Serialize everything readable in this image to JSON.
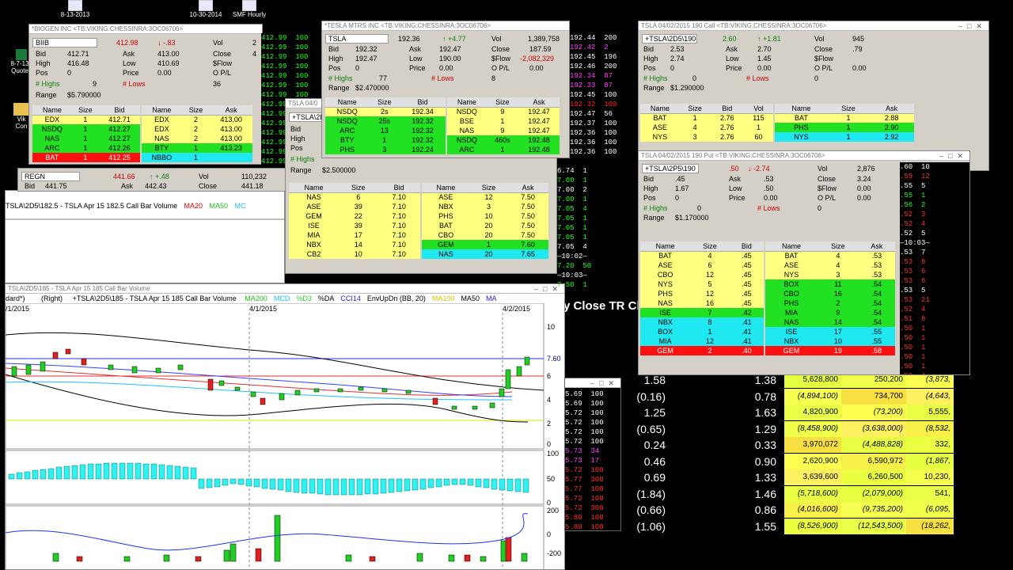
{
  "desktop": {
    "icons": [
      {
        "label": "8-13-2013"
      },
      {
        "label": "10-30-2014"
      },
      {
        "label": "SMF Hourly"
      },
      {
        "label": "8-7-13 Quote"
      },
      {
        "label": "Vik Con"
      }
    ]
  },
  "biib": {
    "title": "*BIOGEN INC <TB:VIKING:CHESSINRA:3OC06706>",
    "symbol": "BIIB",
    "last": "412.98",
    "change": "↓ -.83",
    "vol_label": "Vol",
    "vol": "2",
    "bid_label": "Bid",
    "bid": "412.71",
    "ask_label": "Ask",
    "ask": "413.00",
    "close_label": "Close",
    "close": "4",
    "high_label": "High",
    "high": "416.48",
    "low_label": "Low",
    "low": "410.69",
    "sflow_label": "$Flow",
    "sflow": "",
    "pos_label": "Pos",
    "pos": "0",
    "price_label": "Price",
    "price": "0.00",
    "opl_label": "O P/L",
    "opl": "",
    "highs_label": "# Highs",
    "highs": "9",
    "lows_label": "# Lows",
    "lows": "36",
    "range_label": "Range",
    "range": "$5.790000",
    "headers": [
      "Name",
      "Size",
      "Bid",
      "Name",
      "Size",
      "Ask"
    ],
    "bids": [
      {
        "n": "EDX",
        "s": "1",
        "p": "412.71",
        "c": "y"
      },
      {
        "n": "NSDQ",
        "s": "1",
        "p": "412.27",
        "c": "g"
      },
      {
        "n": "NAS",
        "s": "1",
        "p": "412.27",
        "c": "g"
      },
      {
        "n": "ARC",
        "s": "1",
        "p": "412.26",
        "c": "g"
      },
      {
        "n": "BAT",
        "s": "1",
        "p": "412.25",
        "c": "r"
      }
    ],
    "asks": [
      {
        "n": "EDX",
        "s": "2",
        "p": "413.00",
        "c": "y"
      },
      {
        "n": "EDX",
        "s": "2",
        "p": "413.00",
        "c": "y"
      },
      {
        "n": "NAS",
        "s": "2",
        "p": "413.00",
        "c": "y"
      },
      {
        "n": "BTY",
        "s": "1",
        "p": "413.23",
        "c": "g"
      },
      {
        "n": "NBBO",
        "s": "1",
        "p": "",
        "c": "c"
      }
    ],
    "tape": [
      "412.99  100",
      "412.99  100",
      "412.99  100",
      "412.99  100",
      "412.99  100",
      "412.99  100",
      "412.99  100",
      "412.99  100",
      "412.99  100",
      "412.99  100",
      "412.99  100",
      "412.99  100",
      "412.99  100",
      "412.99  100",
      "412.99  100"
    ]
  },
  "regn": {
    "symbol": "REGN",
    "last": "441.66",
    "change": "↑ +.48",
    "vol_label": "Vol",
    "vol": "110,232",
    "bid_label": "Bid",
    "bid": "441.75",
    "ask_label": "Ask",
    "ask": "442.43",
    "close_label": "Close",
    "close": "441.18"
  },
  "tsla": {
    "title": "*TESLA MTRS INC <TB:VIKING:CHESSINRA:3OC06706>",
    "symbol": "TSLA",
    "last": "192.36",
    "change": "↑ +4.77",
    "vol_label": "Vol",
    "vol": "1,389,758",
    "bid_label": "Bid",
    "bid": "192.32",
    "ask_label": "Ask",
    "ask": "192.47",
    "close_label": "Close",
    "close": "187.59",
    "high_label": "High",
    "high": "192.47",
    "low_label": "Low",
    "low": "190.00",
    "sflow_label": "$Flow",
    "sflow": "-2,082,329",
    "pos_label": "Pos",
    "pos": "0",
    "price_label": "Price",
    "price": "0.00",
    "opl_label": "O P/L",
    "opl": "0.00",
    "highs_label": "# Highs",
    "highs": "77",
    "lows_label": "# Lows",
    "lows": "8",
    "range_label": "Range",
    "range": "$2.470000",
    "headers": [
      "Name",
      "Size",
      "Bid",
      "Name",
      "Size",
      "Ask"
    ],
    "bids": [
      {
        "n": "NSDQ",
        "s": "2s",
        "p": "192.34",
        "c": "y"
      },
      {
        "n": "NSDQ",
        "s": "25s",
        "p": "192.32",
        "c": "g"
      },
      {
        "n": "ARC",
        "s": "13",
        "p": "192.32",
        "c": "g"
      },
      {
        "n": "BTY",
        "s": "1",
        "p": "192.32",
        "c": "g"
      },
      {
        "n": "PHS",
        "s": "3",
        "p": "192.24",
        "c": "g"
      }
    ],
    "asks": [
      {
        "n": "NSDQ",
        "s": "9",
        "p": "192.47",
        "c": "y"
      },
      {
        "n": "BSE",
        "s": "1",
        "p": "192.47",
        "c": "y"
      },
      {
        "n": "NAS",
        "s": "9",
        "p": "192.47",
        "c": "y"
      },
      {
        "n": "NSDQ",
        "s": "460s",
        "p": "192.48",
        "c": "g"
      },
      {
        "n": "ARC",
        "s": "1",
        "p": "192.48",
        "c": "g"
      }
    ],
    "tape": [
      {
        "t": "192.44  200",
        "c": "#ffffff"
      },
      {
        "t": "192.42  2",
        "c": "#ff40ff"
      },
      {
        "t": "192.45  196",
        "c": "#ffffff"
      },
      {
        "t": "192.46  200",
        "c": "#ffffff"
      },
      {
        "t": "192.34  87",
        "c": "#ff40ff"
      },
      {
        "t": "192.33  87",
        "c": "#ff40ff"
      },
      {
        "t": "192.45  100",
        "c": "#ffffff"
      },
      {
        "t": "192.32  100",
        "c": "#ff2020"
      },
      {
        "t": "192.47  56",
        "c": "#ffffff"
      },
      {
        "t": "192.37  100",
        "c": "#ffffff"
      },
      {
        "t": "192.36  100",
        "c": "#ffffff"
      },
      {
        "t": "192.36  100",
        "c": "#ffffff"
      },
      {
        "t": "192.36  100",
        "c": "#ffffff"
      }
    ]
  },
  "tsla_opt_mid": {
    "title": "TSLA 04/0",
    "symbol": "+TSLA\\2D",
    "bid_label": "Bid",
    "high_label": "High",
    "pos_label": "Pos",
    "highs_label": "# Highs",
    "range_label": "Range",
    "range": "$2.500000",
    "headers": [
      "Name",
      "Size",
      "Bid",
      "Name",
      "Size",
      "Ask"
    ],
    "bids": [
      {
        "n": "NAS",
        "s": "6",
        "p": "7.10"
      },
      {
        "n": "ASE",
        "s": "39",
        "p": "7.10"
      },
      {
        "n": "GEM",
        "s": "22",
        "p": "7.10"
      },
      {
        "n": "ISE",
        "s": "39",
        "p": "7.10"
      },
      {
        "n": "MIA",
        "s": "17",
        "p": "7.10"
      },
      {
        "n": "NBX",
        "s": "14",
        "p": "7.10"
      },
      {
        "n": "CB2",
        "s": "10",
        "p": "7.10"
      }
    ],
    "asks": [
      {
        "n": "ASE",
        "s": "12",
        "p": "7.50",
        "c": "y"
      },
      {
        "n": "NBX",
        "s": "3",
        "p": "7.50",
        "c": "y"
      },
      {
        "n": "PHS",
        "s": "10",
        "p": "7.50",
        "c": "y"
      },
      {
        "n": "BAT",
        "s": "20",
        "p": "7.50",
        "c": "y"
      },
      {
        "n": "CBO",
        "s": "20",
        "p": "7.50",
        "c": "y"
      },
      {
        "n": "GEM",
        "s": "1",
        "p": "7.60",
        "c": "g"
      },
      {
        "n": "NAS",
        "s": "20",
        "p": "7.65",
        "c": "c"
      }
    ],
    "tape": [
      {
        "t": "6.74  1",
        "c": "#ffffff"
      },
      {
        "t": "7.00  1",
        "c": "#20ff20"
      },
      {
        "t": "7.00  2",
        "c": "#ffffff"
      },
      {
        "t": "7.00  1",
        "c": "#20ff20"
      },
      {
        "t": "7.05  4",
        "c": "#20ff20"
      },
      {
        "t": "7.05  1",
        "c": "#20ff20"
      },
      {
        "t": "7.05  1",
        "c": "#20ff20"
      },
      {
        "t": "7.05  1",
        "c": "#20ff20"
      },
      {
        "t": "7.05  4",
        "c": "#ffffff"
      },
      {
        "t": "—10:02—",
        "c": "#ffffff"
      },
      {
        "t": "7.20  50",
        "c": "#20ff20"
      },
      {
        "t": "—10:03—",
        "c": "#ffffff"
      },
      {
        "t": "7.50  1",
        "c": "#20ff20"
      }
    ]
  },
  "call190": {
    "title": "TSLA 04/02/2015 190 Call <TB:VIKING:CHESSINRA:3OC06706>",
    "symbol": "+TSLA\\2D5\\190",
    "last": "2.60",
    "change": "↑ +1.81",
    "vol_label": "Vol",
    "vol": "945",
    "bid_label": "Bid",
    "bid": "2.53",
    "ask_label": "Ask",
    "ask": "2.70",
    "close_label": "Close",
    "close": ".79",
    "high_label": "High",
    "high": "2.74",
    "low_label": "Low",
    "low": "1.45",
    "sflow_label": "$Flow",
    "sflow": "",
    "pos_label": "Pos",
    "pos": "0",
    "price_label": "Price",
    "price": "0.00",
    "opl_label": "O P/L",
    "opl": "0.00",
    "highs_label": "# Highs",
    "highs": "0",
    "lows_label": "# Lows",
    "lows": "0",
    "range_label": "Range",
    "range": "$1.290000",
    "headers": [
      "Name",
      "Size",
      "Bid",
      "Vol",
      "Name",
      "Size",
      "Ask"
    ],
    "bids": [
      {
        "n": "BAT",
        "s": "1",
        "p": "2.76",
        "v": "115"
      },
      {
        "n": "ASE",
        "s": "4",
        "p": "2.76",
        "v": "1"
      },
      {
        "n": "NYS",
        "s": "3",
        "p": "2.76",
        "v": "60"
      }
    ],
    "asks": [
      {
        "n": "BAT",
        "s": "1",
        "p": "2.88",
        "c": "y"
      },
      {
        "n": "PHS",
        "s": "1",
        "p": "2.90",
        "c": "g"
      },
      {
        "n": "NYS",
        "s": "1",
        "p": "2.92",
        "c": "c"
      }
    ]
  },
  "put190": {
    "title": "TSLA 04/02/2015 190 Put <TB:VIKING:CHESSINRA:3OC06706>",
    "symbol": "+TSLA\\2P5\\190",
    "last": ".50",
    "change": "↓ -2.74",
    "vol_label": "Vol",
    "vol": "2,876",
    "bid_label": "Bid",
    "bid": ".45",
    "ask_label": "Ask",
    "ask": ".53",
    "close_label": "Close",
    "close": "3.24",
    "high_label": "High",
    "high": "1.67",
    "low_label": "Low",
    "low": ".50",
    "sflow_label": "$Flow",
    "sflow": "0.00",
    "pos_label": "Pos",
    "pos": "0",
    "price_label": "Price",
    "price": "0.00",
    "opl_label": "O P/L",
    "opl": "0.00",
    "highs_label": "# Highs",
    "highs": "0",
    "lows_label": "# Lows",
    "lows": "0",
    "range_label": "Range",
    "range": "$1.170000",
    "headers": [
      "Name",
      "Size",
      "Bid",
      "Name",
      "Size",
      "Ask"
    ],
    "bids": [
      {
        "n": "BAT",
        "s": "4",
        "p": ".45",
        "c": "y"
      },
      {
        "n": "ASE",
        "s": "6",
        "p": ".45",
        "c": "y"
      },
      {
        "n": "CBO",
        "s": "12",
        "p": ".45",
        "c": "y"
      },
      {
        "n": "NYS",
        "s": "5",
        "p": ".45",
        "c": "y"
      },
      {
        "n": "PHS",
        "s": "12",
        "p": ".45",
        "c": "y"
      },
      {
        "n": "NAS",
        "s": "16",
        "p": ".45",
        "c": "y"
      },
      {
        "n": "ISE",
        "s": "7",
        "p": ".42",
        "c": "g"
      },
      {
        "n": "NBX",
        "s": "8",
        "p": ".41",
        "c": "c"
      },
      {
        "n": "BOX",
        "s": "1",
        "p": ".41",
        "c": "c"
      },
      {
        "n": "MIA",
        "s": "12",
        "p": ".41",
        "c": "c"
      },
      {
        "n": "GEM",
        "s": "2",
        "p": ".40",
        "c": "r"
      }
    ],
    "asks": [
      {
        "n": "BAT",
        "s": "4",
        "p": ".53",
        "c": "y"
      },
      {
        "n": "ASE",
        "s": "4",
        "p": ".53",
        "c": "y"
      },
      {
        "n": "NYS",
        "s": "3",
        "p": ".53",
        "c": "y"
      },
      {
        "n": "BOX",
        "s": "11",
        "p": ".54",
        "c": "g"
      },
      {
        "n": "CBO",
        "s": "16",
        "p": ".54",
        "c": "g"
      },
      {
        "n": "PHS",
        "s": "2",
        "p": ".54",
        "c": "g"
      },
      {
        "n": "MIA",
        "s": "9",
        "p": ".54",
        "c": "g"
      },
      {
        "n": "NAS",
        "s": "14",
        "p": ".54",
        "c": "g"
      },
      {
        "n": "ISE",
        "s": "17",
        "p": ".55",
        "c": "c"
      },
      {
        "n": "NBX",
        "s": "10",
        "p": ".55",
        "c": "c"
      },
      {
        "n": "GEM",
        "s": "19",
        "p": ".58",
        "c": "r"
      }
    ],
    "tape": [
      {
        "t": ".60  10",
        "c": "#ffffff"
      },
      {
        "t": ".59  12",
        "c": "#ff3030"
      },
      {
        "t": ".55  5",
        "c": "#ffffff"
      },
      {
        "t": ".55  1",
        "c": "#20ff20"
      },
      {
        "t": ".56  2",
        "c": "#20ff20"
      },
      {
        "t": ".52  3",
        "c": "#ff3030"
      },
      {
        "t": ".52  4",
        "c": "#ff3030"
      },
      {
        "t": ".52  5",
        "c": "#ffffff"
      },
      {
        "t": "—10:03—",
        "c": "#ffffff"
      },
      {
        "t": ".53  7",
        "c": "#ffffff"
      },
      {
        "t": ".53  8",
        "c": "#ff3030"
      },
      {
        "t": ".53  6",
        "c": "#ff3030"
      },
      {
        "t": ".53  6",
        "c": "#ff3030"
      },
      {
        "t": ".53  5",
        "c": "#ffffff"
      },
      {
        "t": ".53  21",
        "c": "#ff3030"
      },
      {
        "t": ".52  4",
        "c": "#ff3030"
      },
      {
        "t": ".51  8",
        "c": "#ff3030"
      },
      {
        "t": ".50  1",
        "c": "#ff3030"
      },
      {
        "t": ".50  1",
        "c": "#ff3030"
      },
      {
        "t": ".50  1",
        "c": "#ff3030"
      },
      {
        "t": ".50  1",
        "c": "#ff3030"
      },
      {
        "t": ".50  1",
        "c": "#ff3030"
      },
      {
        "t": ".50  4",
        "c": "#ff3030"
      }
    ]
  },
  "chart_top": {
    "label": "TSLA\\2D5\\182.5 - TSLA  Apr 15  182.5 Call  Bar  Volume",
    "ind": [
      "MA20",
      "MA50",
      "MC"
    ]
  },
  "chart_main": {
    "title": "TSLA\\2D5\\185 - TSLA Apr 15 185 Call Bar Volume",
    "left_label": "dard*)",
    "right_label": "(Right)",
    "symbol": "+TSLA\\2D5\\185 - TSLA  Apr 15  185 Call  Bar  Volume",
    "ind": [
      {
        "t": "MA200",
        "c": "#22c022"
      },
      {
        "t": "MCD",
        "c": "#20c0ff"
      },
      {
        "t": "%D3",
        "c": "#30d030"
      },
      {
        "t": "%DA",
        "c": "#000000"
      },
      {
        "t": "CCI14",
        "c": "#2020ff"
      },
      {
        "t": "EnvUpDn (BB, 20)",
        "c": "#000000"
      },
      {
        "t": "MA100",
        "c": "#e0c000"
      },
      {
        "t": "MA50",
        "c": "#000000"
      },
      {
        "t": "MA",
        "c": "#2020ff"
      }
    ],
    "dates": [
      "/1/2015",
      "4/1/2015",
      "4/2/2015"
    ],
    "price_axis": [
      "10",
      "7.60",
      "6",
      "4",
      "2",
      "0"
    ],
    "vol_axis": [
      "100",
      "50",
      "0"
    ],
    "cci_axis": [
      "200",
      "0",
      "-200"
    ],
    "last_price": "7.60"
  },
  "small_tape": {
    "rows": [
      "5.69  100",
      "5.69  100",
      "5.72  100",
      "5.72  100",
      "5.72  100",
      "5.72  100",
      "5.73  34",
      "5.73  17",
      "5.72  100",
      "5.77  300",
      "5.77  100",
      "5.72  100",
      "5.72  300",
      "5.80  100",
      "5.80  100",
      "5.62  40"
    ]
  },
  "heading_fragment": "y Close TR Ch",
  "spreadsheet": {
    "rows": [
      {
        "a": "1.58",
        "b": "1.38",
        "c": "5,628,800",
        "d": "250,200",
        "e": "(3,873,"
      },
      {
        "a": "(0.16)",
        "b": "0.78",
        "c": "(4,894,100)",
        "d": "734,700",
        "e": "(4,643,"
      },
      {
        "a": "1.25",
        "b": "1.63",
        "c": "4,820,900",
        "d": "(73,200)",
        "e": "5,555,"
      },
      {
        "a": "(0.65)",
        "b": "1.29",
        "c": "(8,458,900)",
        "d": "(3,638,000)",
        "e": "(8,532,"
      },
      {
        "a": "0.24",
        "b": "0.33",
        "c": "3,970,072",
        "d": "(4,488,828)",
        "e": "332,"
      },
      {
        "a": "0.46",
        "b": "0.90",
        "c": "2,620,900",
        "d": "6,590,972",
        "e": "(1,867,"
      },
      {
        "a": "0.69",
        "b": "1.33",
        "c": "3,639,600",
        "d": "6,260,500",
        "e": "10,230,"
      },
      {
        "a": "(1.84)",
        "b": "1.46",
        "c": "(5,718,600)",
        "d": "(2,079,000)",
        "e": "541,"
      },
      {
        "a": "(0.66)",
        "b": "0.86",
        "c": "(4,016,600)",
        "d": "(9,735,200)",
        "e": "(6,095,"
      },
      {
        "a": "(1.06)",
        "b": "1.55",
        "c": "(8,526,900)",
        "d": "(12,543,500)",
        "e": "(18,262,"
      }
    ]
  },
  "colors": {
    "yellow": "#ffff80",
    "green": "#22e022",
    "cyan": "#20e8f0",
    "red": "#ff1010"
  }
}
